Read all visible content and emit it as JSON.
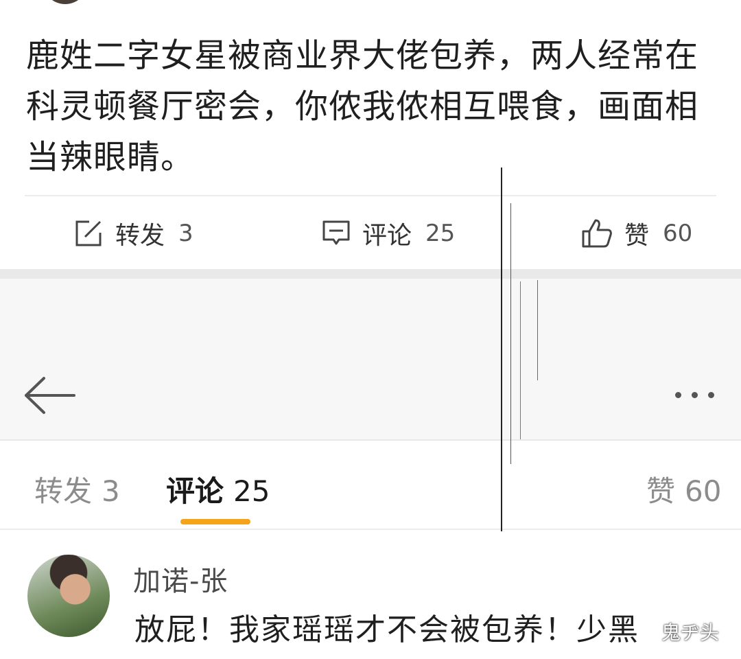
{
  "post": {
    "text": "鹿姓二字女星被商业界大佬包养，两人经常在科灵顿餐厅密会，你侬我侬相互喂食，画面相当辣眼睛。"
  },
  "actions": {
    "repost_label": "转发",
    "repost_count": "3",
    "comment_label": "评论",
    "comment_count": "25",
    "like_label": "赞",
    "like_count": "60"
  },
  "tabs": {
    "repost_label": "转发",
    "repost_count": "3",
    "comment_label": "评论",
    "comment_count": "25",
    "like_label": "赞",
    "like_count": "60",
    "active": "comment",
    "accent_color": "#f5a31a"
  },
  "comment": {
    "username": "加诺-张",
    "text": "放屁！我家瑶瑶才不会被包养！少黑"
  },
  "watermark": {
    "text": "鬼ヂ头"
  },
  "icons": {
    "repost": "edit-square-icon",
    "comment": "comment-bubble-icon",
    "like": "thumbs-up-icon",
    "back": "back-arrow-icon",
    "more": "more-dots-icon"
  }
}
